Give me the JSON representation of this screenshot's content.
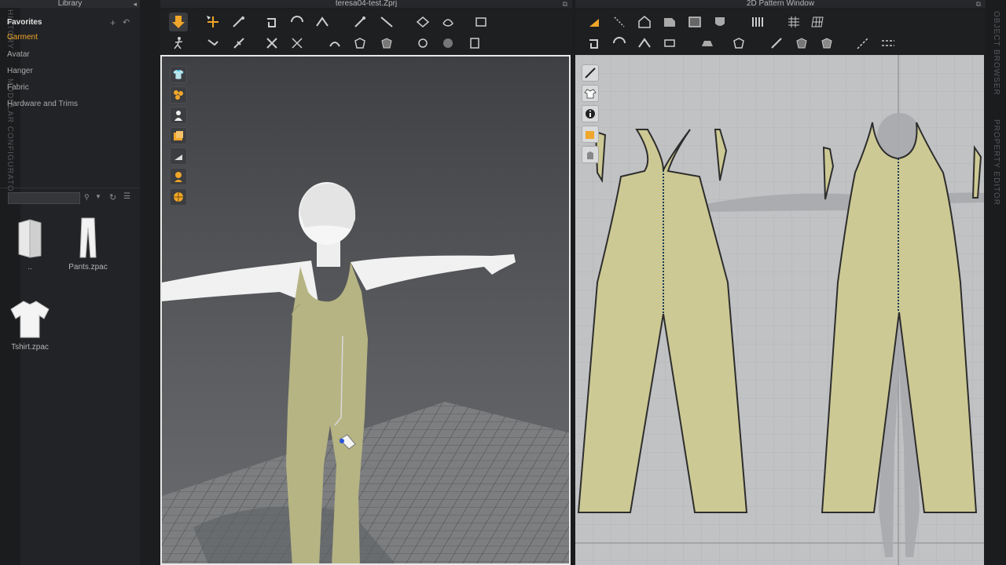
{
  "library": {
    "title": "Library",
    "favorites_heading": "Favorites",
    "favorites": [
      "Garment",
      "Avatar",
      "Hanger",
      "Fabric",
      "Hardware and Trims"
    ],
    "search_placeholder": "",
    "files": [
      {
        "name": "..",
        "icon": "folder-icon"
      },
      {
        "name": "Pants.zpac",
        "icon": "pants-icon"
      },
      {
        "name": "Tshirt.zpac",
        "icon": "tshirt-icon"
      }
    ]
  },
  "left_tabs": [
    "HISTORY",
    "MODULAR CONFIGURATOR"
  ],
  "right_tabs": [
    "OBJECT BROWSER",
    "PROPERTY EDITOR"
  ],
  "window_3d": {
    "title": "teresa04-test.Zprj"
  },
  "window_2d": {
    "title": "2D Pattern Window"
  },
  "colors": {
    "accent": "#f0a62a",
    "fabric": "#cdc994",
    "background_3d": "#55575a",
    "background_2d": "#bfc0c2"
  }
}
